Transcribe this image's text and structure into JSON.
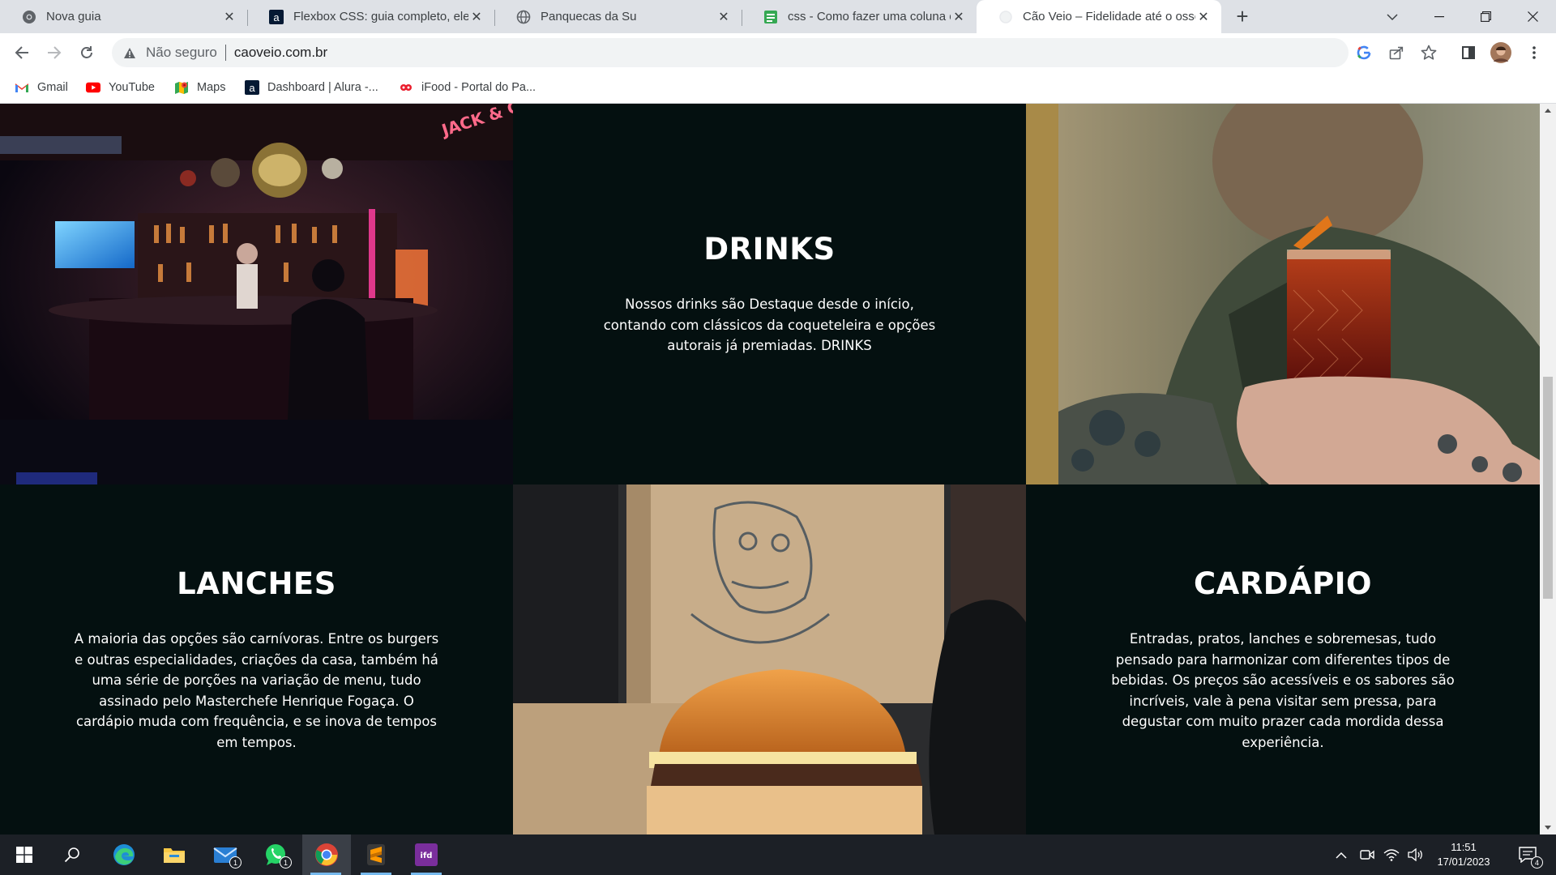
{
  "browser": {
    "tabs": [
      {
        "title": "Nova guia",
        "favicon": "chrome-icon",
        "active": false
      },
      {
        "title": "Flexbox CSS: guia completo, elem",
        "favicon": "alura-icon",
        "active": false
      },
      {
        "title": "Panquecas da Su",
        "favicon": "globe-icon",
        "active": false
      },
      {
        "title": "css - Como fazer uma coluna ocu",
        "favicon": "stackoverflow-icon",
        "active": false
      },
      {
        "title": "Cão Veio – Fidelidade até o osso!",
        "favicon": "loading-icon",
        "active": true
      }
    ],
    "new_tab_label": "+",
    "omnibox": {
      "security_label": "Não seguro",
      "url": "caoveio.com.br"
    },
    "bookmarks": [
      {
        "label": "Gmail",
        "icon": "gmail-icon"
      },
      {
        "label": "YouTube",
        "icon": "youtube-icon"
      },
      {
        "label": "Maps",
        "icon": "maps-icon"
      },
      {
        "label": "Dashboard | Alura -...",
        "icon": "alura-icon"
      },
      {
        "label": "iFood - Portal do Pa...",
        "icon": "ifood-icon"
      }
    ]
  },
  "page": {
    "drinks": {
      "heading": "DRINKS",
      "text": "Nossos drinks são Destaque desde o início, contando com clássicos da coqueteleira e opções autorais já premiadas. DRINKS"
    },
    "lanches": {
      "heading": "LANCHES",
      "text": "A maioria das opções são carnívoras. Entre os burgers e outras especialidades, criações da casa, também há uma série de porções na variação de menu, tudo assinado pelo Masterchefe Henrique Fogaça. O cardápio muda com frequência, e se inova de tempos em tempos."
    },
    "cardapio": {
      "heading": "CARDÁPIO",
      "text": "Entradas, pratos, lanches e sobremesas, tudo pensado para harmonizar com diferentes tipos de bebidas. Os preços são acessíveis e os sabores são incríveis, vale à pena visitar sem pressa, para degustar com muito prazer cada mordida dessa experiência."
    },
    "bar_sign": "JACK & COKE",
    "colors": {
      "section_bg": "#041010",
      "text": "#ffffff"
    }
  },
  "taskbar": {
    "apps": [
      "windows-start-icon",
      "search-icon",
      "edge-icon",
      "file-explorer-icon",
      "mail-icon",
      "whatsapp-icon",
      "chrome-icon",
      "sublime-text-icon",
      "ifood-app-icon"
    ],
    "mail_badge": "1",
    "whatsapp_badge": "1",
    "time": "11:51",
    "date": "17/01/2023",
    "notification_count": "4"
  }
}
